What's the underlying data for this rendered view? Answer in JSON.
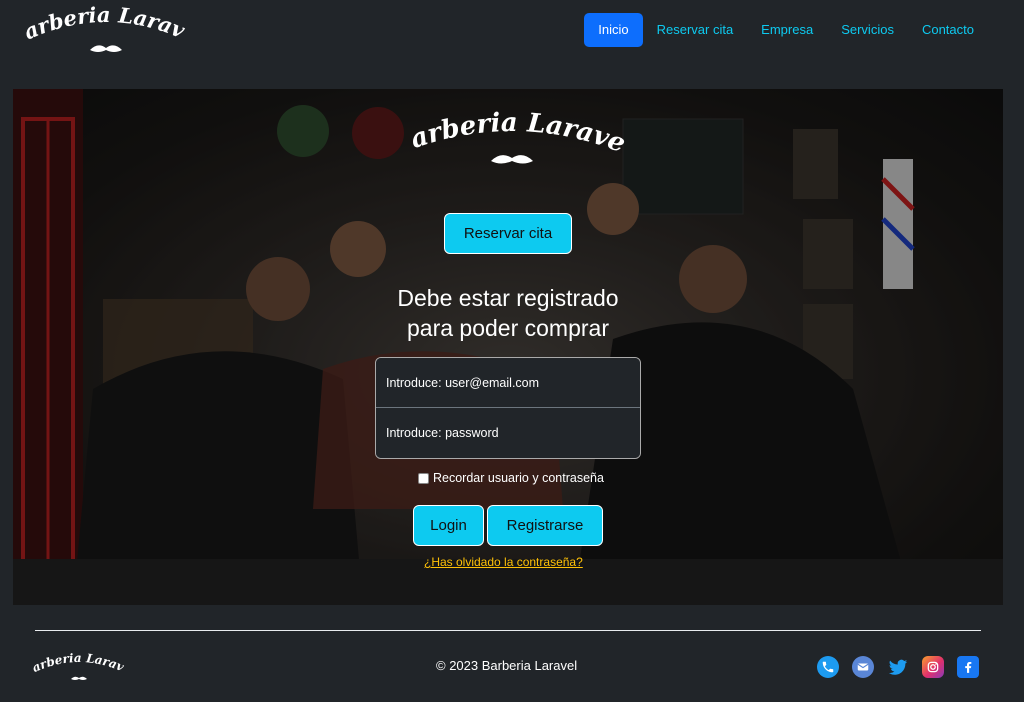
{
  "brand": {
    "name": "Barberia Laravel"
  },
  "nav": {
    "items": [
      {
        "label": "Inicio",
        "active": true
      },
      {
        "label": "Reservar cita",
        "active": false
      },
      {
        "label": "Empresa",
        "active": false
      },
      {
        "label": "Servicios",
        "active": false
      },
      {
        "label": "Contacto",
        "active": false
      }
    ]
  },
  "hero": {
    "logo_text": "Barberia Laravel",
    "reserve_button": "Reservar cita",
    "title_line1": "Debe estar registrado",
    "title_line2": "para poder comprar",
    "email_placeholder": "Introduce: user@email.com",
    "password_placeholder": "Introduce: password",
    "remember_label": "Recordar usuario y contraseña",
    "login_button": "Login",
    "register_button": "Registrarse",
    "forgot_link": "¿Has olvidado la contraseña?"
  },
  "footer": {
    "logo_text": "Barberia Laravel",
    "copyright": "© 2023 Barberia Laravel",
    "socials": [
      "phone-icon",
      "mail-icon",
      "twitter-icon",
      "instagram-icon",
      "facebook-icon"
    ]
  },
  "colors": {
    "page_bg": "#212529",
    "accent_cyan": "#0dcaf0",
    "primary_blue": "#0d6efd",
    "link_yellow": "#ffc107"
  }
}
